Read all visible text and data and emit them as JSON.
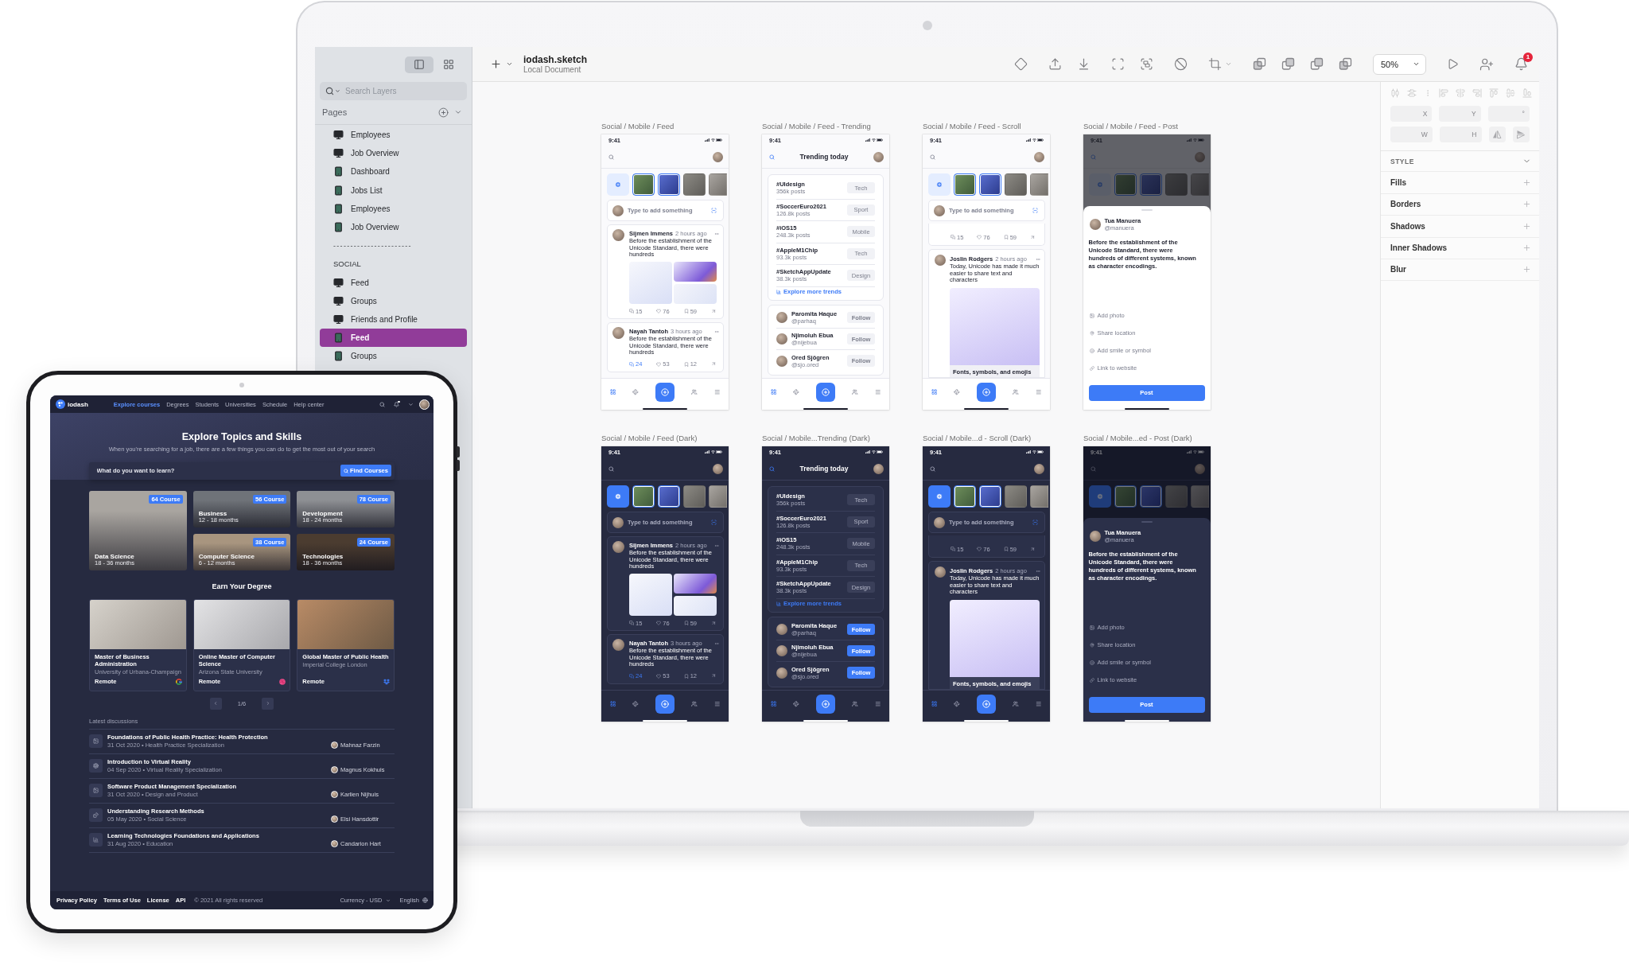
{
  "sketch": {
    "sidebar": {
      "view_toggles": [
        {
          "selected": true
        },
        {
          "selected": false
        }
      ],
      "search": {
        "placeholder": "Search Layers"
      },
      "pages_title": "Pages",
      "pages": [
        {
          "kind": "desktop",
          "label": "Employees",
          "selected": false
        },
        {
          "kind": "desktop",
          "label": "Job Overview",
          "selected": false
        },
        {
          "kind": "mobile",
          "label": "Dashboard",
          "selected": false
        },
        {
          "kind": "mobile",
          "label": "Jobs List",
          "selected": false
        },
        {
          "kind": "mobile",
          "label": "Employees",
          "selected": false
        },
        {
          "kind": "mobile",
          "label": "Job Overview",
          "selected": false
        },
        {
          "kind": "divider",
          "label": "-----------------------"
        },
        {
          "kind": "heading",
          "label": "SOCIAL"
        },
        {
          "kind": "desktop",
          "label": "Feed",
          "selected": false
        },
        {
          "kind": "desktop",
          "label": "Groups",
          "selected": false
        },
        {
          "kind": "desktop",
          "label": "Friends and Profile",
          "selected": false
        },
        {
          "kind": "mobile",
          "label": "Feed",
          "selected": true
        },
        {
          "kind": "mobile",
          "label": "Groups",
          "selected": false
        }
      ]
    },
    "toolbar": {
      "title": "iodash.sketch",
      "subtitle": "Local Document",
      "zoom": "50%",
      "notification_count": "1"
    },
    "inspector": {
      "fields": [
        {
          "label": "X"
        },
        {
          "label": "Y"
        },
        {
          "label": "°"
        },
        {
          "label": "W"
        },
        {
          "label": "H"
        }
      ],
      "style_title": "STYLE",
      "sections": [
        "Fills",
        "Borders",
        "Shadows",
        "Inner Shadows",
        "Blur"
      ]
    },
    "artboards": [
      {
        "kind": "feed",
        "dark": false,
        "label": "Social / Mobile / Feed",
        "time": "9:41",
        "stories": [
          {
            "highlighted": true
          },
          {
            "highlighted": true
          },
          {
            "highlighted": false
          },
          {
            "highlighted": false
          }
        ],
        "composer": {
          "placeholder": "Type to add something"
        },
        "posts": [
          {
            "author": "Sijmen Immens",
            "time": "2 hours ago",
            "text": "Before the establishment of the Unicode Standard, there were hundreds",
            "has_images": true,
            "comments": "15",
            "likes": "76",
            "saves": "59",
            "comments_highlighted": false
          },
          {
            "author": "Nayah Tantoh",
            "time": "3 hours ago",
            "text": "Before the establishment of the Unicode Standard, there were hundreds",
            "has_images": false,
            "comments": "24",
            "likes": "53",
            "saves": "12",
            "comments_highlighted": true
          }
        ],
        "nav": [
          {
            "selected": true
          },
          {
            "selected": false
          },
          {
            "selected": false
          },
          {
            "selected": false
          }
        ]
      },
      {
        "kind": "trending",
        "dark": false,
        "label": "Social / Mobile / Feed - Trending",
        "time": "9:41",
        "title": "Trending today",
        "trends": [
          {
            "tag": "#UIdesign",
            "count": "356k posts",
            "topic": "Tech"
          },
          {
            "tag": "#SoccerEuro2021",
            "count": "126.8k posts",
            "topic": "Sport"
          },
          {
            "tag": "#iOS15",
            "count": "248.3k posts",
            "topic": "Mobile"
          },
          {
            "tag": "#AppleM1Chip",
            "count": "93.3k posts",
            "topic": "Tech"
          },
          {
            "tag": "#SketchAppUpdate",
            "count": "38.3k posts",
            "topic": "Design"
          }
        ],
        "explore": "Explore more trends",
        "people": [
          {
            "name": "Paromita Haque",
            "handle": "@parhaq",
            "action": "Follow"
          },
          {
            "name": "Njimoluh Ebua",
            "handle": "@nijebua",
            "action": "Follow"
          },
          {
            "name": "Ored Sjögren",
            "handle": "@sjo.ored",
            "action": "Follow"
          }
        ],
        "nav": [
          {
            "selected": true
          },
          {
            "selected": false
          },
          {
            "selected": false
          },
          {
            "selected": false
          }
        ]
      },
      {
        "kind": "scroll",
        "dark": false,
        "label": "Social / Mobile / Feed - Scroll",
        "time": "9:41",
        "stories": [
          {
            "highlighted": true
          },
          {
            "highlighted": true
          },
          {
            "highlighted": false
          },
          {
            "highlighted": false
          }
        ],
        "composer": {
          "placeholder": "Type to add something"
        },
        "previous_post": {
          "comments": "15",
          "likes": "76",
          "saves": "59"
        },
        "post": {
          "author": "Joslin Rodgers",
          "time": "2 hours ago",
          "text": "Today, Unicode has made it much easier to share text and characters",
          "caption": "Fonts, symbols, and emojis"
        },
        "nav": [
          {
            "selected": true
          },
          {
            "selected": false
          },
          {
            "selected": false
          },
          {
            "selected": false
          }
        ]
      },
      {
        "kind": "post",
        "dark": false,
        "label": "Social / Mobile / Feed - Post",
        "time": "9:41",
        "stories": [
          {
            "highlighted": true
          },
          {
            "highlighted": true
          },
          {
            "highlighted": false
          },
          {
            "highlighted": false
          }
        ],
        "author": "Tua Manuera",
        "handle": "@manuera",
        "text": "Before the establishment of the Unicode Standard, there were hundreds of different systems, known as character encodings.",
        "options": [
          "Add photo",
          "Share location",
          "Add smile or symbol",
          "Link to website"
        ],
        "button": "Post"
      },
      {
        "kind": "feed",
        "dark": true,
        "label": "Social / Mobile / Feed (Dark)",
        "time": "9:41",
        "stories": [
          {
            "highlighted": true
          },
          {
            "highlighted": true
          },
          {
            "highlighted": false
          },
          {
            "highlighted": false
          }
        ],
        "composer": {
          "placeholder": "Type to add something"
        },
        "posts": [
          {
            "author": "Sijmen Immens",
            "time": "2 hours ago",
            "text": "Before the establishment of the Unicode Standard, there were hundreds",
            "has_images": true,
            "comments": "15",
            "likes": "76",
            "saves": "59",
            "comments_highlighted": false
          },
          {
            "author": "Nayah Tantoh",
            "time": "3 hours ago",
            "text": "Before the establishment of the Unicode Standard, there were hundreds",
            "has_images": false,
            "comments": "24",
            "likes": "53",
            "saves": "12",
            "comments_highlighted": true
          }
        ],
        "nav": [
          {
            "selected": true
          },
          {
            "selected": false
          },
          {
            "selected": false
          },
          {
            "selected": false
          }
        ]
      },
      {
        "kind": "trending",
        "dark": true,
        "label": "Social / Mobile...Trending (Dark)",
        "time": "9:41",
        "title": "Trending today",
        "trends": [
          {
            "tag": "#UIdesign",
            "count": "356k posts",
            "topic": "Tech"
          },
          {
            "tag": "#SoccerEuro2021",
            "count": "126.8k posts",
            "topic": "Sport"
          },
          {
            "tag": "#iOS15",
            "count": "248.3k posts",
            "topic": "Mobile"
          },
          {
            "tag": "#AppleM1Chip",
            "count": "93.3k posts",
            "topic": "Tech"
          },
          {
            "tag": "#SketchAppUpdate",
            "count": "38.3k posts",
            "topic": "Design"
          }
        ],
        "explore": "Explore more trends",
        "people": [
          {
            "name": "Paromita Haque",
            "handle": "@parhaq",
            "action": "Follow"
          },
          {
            "name": "Njimoluh Ebua",
            "handle": "@nijebua",
            "action": "Follow"
          },
          {
            "name": "Ored Sjögren",
            "handle": "@sjo.ored",
            "action": "Follow"
          }
        ],
        "nav": [
          {
            "selected": true
          },
          {
            "selected": false
          },
          {
            "selected": false
          },
          {
            "selected": false
          }
        ]
      },
      {
        "kind": "scroll",
        "dark": true,
        "label": "Social / Mobile...d - Scroll (Dark)",
        "time": "9:41",
        "stories": [
          {
            "highlighted": true
          },
          {
            "highlighted": true
          },
          {
            "highlighted": false
          },
          {
            "highlighted": false
          }
        ],
        "composer": {
          "placeholder": "Type to add something"
        },
        "previous_post": {
          "comments": "15",
          "likes": "76",
          "saves": "59"
        },
        "post": {
          "author": "Joslin Rodgers",
          "time": "2 hours ago",
          "text": "Today, Unicode has made it much easier to share text and characters",
          "caption": "Fonts, symbols, and emojis"
        },
        "nav": [
          {
            "selected": true
          },
          {
            "selected": false
          },
          {
            "selected": false
          },
          {
            "selected": false
          }
        ]
      },
      {
        "kind": "post",
        "dark": true,
        "label": "Social / Mobile...ed - Post (Dark)",
        "time": "9:41",
        "stories": [
          {
            "highlighted": true
          },
          {
            "highlighted": true
          },
          {
            "highlighted": false
          },
          {
            "highlighted": false
          }
        ],
        "author": "Tua Manuera",
        "handle": "@manuera",
        "text": "Before the establishment of the Unicode Standard, there were hundreds of different systems, known as character encodings.",
        "options": [
          "Add photo",
          "Share location",
          "Add smile or symbol",
          "Link to website"
        ],
        "button": "Post"
      }
    ]
  },
  "tablet": {
    "nav": {
      "brand": "iodash",
      "links": [
        {
          "label": "Explore courses",
          "selected": true
        },
        {
          "label": "Degrees",
          "selected": false
        },
        {
          "label": "Students",
          "selected": false
        },
        {
          "label": "Universities",
          "selected": false
        },
        {
          "label": "Schedule",
          "selected": false
        },
        {
          "label": "Help center",
          "selected": false
        }
      ],
      "bell_badge": true
    },
    "hero": {
      "title": "Explore Topics and Skills",
      "subtitle": "When you're searching for a job, there are a few things you can do to get the most out of your search"
    },
    "search": {
      "placeholder": "What do you want to learn?",
      "button": "Find Courses"
    },
    "topics": [
      {
        "title": "Data Science",
        "duration": "18 - 36 months",
        "badge": "64 Course"
      },
      {
        "title": "Business",
        "duration": "12 - 18 months",
        "badge": "56 Course"
      },
      {
        "title": "Development",
        "duration": "18 - 24 months",
        "badge": "78 Course"
      },
      {
        "title": "Computer Science",
        "duration": "6 - 12 months",
        "badge": "38 Course"
      },
      {
        "title": "Technologies",
        "duration": "18 - 36 months",
        "badge": "24 Course"
      }
    ],
    "degrees_title": "Earn Your Degree",
    "degrees": [
      {
        "title": "Master of Business Administration",
        "school": "University of Urbana-Champaign",
        "mode": "Remote"
      },
      {
        "title": "Online Master of Computer Science",
        "school": "Arizona State University",
        "mode": "Remote"
      },
      {
        "title": "Global Master of Public Health",
        "school": "Imperial College London",
        "mode": "Remote"
      }
    ],
    "pagination": {
      "page": "1/6"
    },
    "discussions_title": "Latest discussions",
    "discussions": [
      {
        "title": "Foundations of Public Health Practice: Health Protection",
        "meta": "31 Oct 2020 • Health Practice Specialization",
        "author": "Mahnaz Farzin"
      },
      {
        "title": "Introduction to Virtual Reality",
        "meta": "04 Sep 2020 • Virtual Reality Specialization",
        "author": "Magnus Kokhuis"
      },
      {
        "title": "Software Product Management Specialization",
        "meta": "31 Oct 2020 • Design and Product",
        "author": "Karlien Nijhuis"
      },
      {
        "title": "Understanding Research Methods",
        "meta": "05 May 2020 • Social Science",
        "author": "Elsi Hansdottir"
      },
      {
        "title": "Learning Technologies Foundations and Applications",
        "meta": "31 Aug 2020 • Education",
        "author": "Candarion Hart"
      }
    ],
    "footer": {
      "links": [
        "Privacy Policy",
        "Terms of Use",
        "License",
        "API"
      ],
      "copyright": "© 2021 All rights reserved",
      "currency": "Currency - USD",
      "language": "English"
    }
  }
}
